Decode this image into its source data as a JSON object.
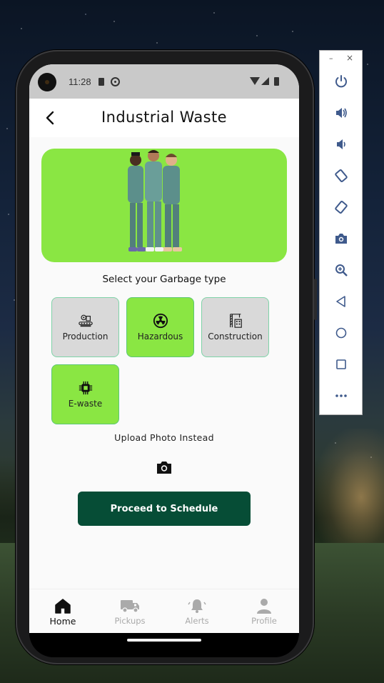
{
  "status_bar": {
    "time": "11:28"
  },
  "app_bar": {
    "title": "Industrial Waste"
  },
  "section_title": "Select your Garbage type",
  "garbage_types": [
    {
      "label": "Production",
      "icon": "factory-icon",
      "selected": false
    },
    {
      "label": "Hazardous",
      "icon": "radiation-icon",
      "selected": true
    },
    {
      "label": "Construction",
      "icon": "crane-icon",
      "selected": false
    },
    {
      "label": "E-waste",
      "icon": "chip-icon",
      "selected": true
    }
  ],
  "upload_text": "Upload Photo Instead",
  "proceed_button": "Proceed to Schedule",
  "bottom_nav": [
    {
      "label": "Home",
      "icon": "home-icon",
      "active": true
    },
    {
      "label": "Pickups",
      "icon": "truck-icon",
      "active": false
    },
    {
      "label": "Alerts",
      "icon": "bell-icon",
      "active": false
    },
    {
      "label": "Profile",
      "icon": "person-icon",
      "active": false
    }
  ],
  "emulator_toolbar": {
    "minimize": "–",
    "close": "×",
    "buttons": [
      "power-icon",
      "volume-up-icon",
      "volume-down-icon",
      "rotate-left-icon",
      "rotate-right-icon",
      "screenshot-icon",
      "zoom-icon",
      "back-icon",
      "home-icon",
      "overview-icon",
      "more-icon"
    ]
  },
  "colors": {
    "accent_green": "#8ae643",
    "button_dark_green": "#064d36",
    "tile_grey": "#d9d9d9",
    "tile_border": "#7fd3a8"
  }
}
